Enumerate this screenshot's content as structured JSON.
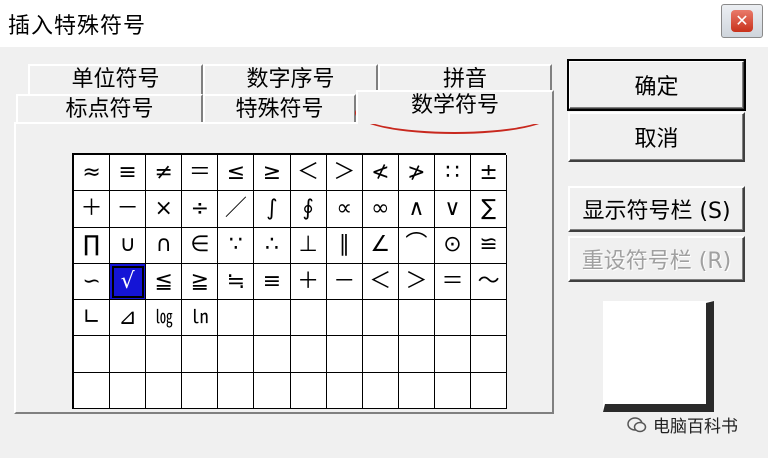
{
  "window": {
    "title": "插入特殊符号",
    "close_glyph": "✕"
  },
  "tabs": {
    "row_back": [
      "单位符号",
      "数字序号",
      "拼音"
    ],
    "row_front": [
      "标点符号",
      "特殊符号",
      "数学符号"
    ],
    "active": "数学符号"
  },
  "symbols": [
    "≈",
    "≡",
    "≠",
    "＝",
    "≤",
    "≥",
    "＜",
    "＞",
    "≮",
    "≯",
    "∷",
    "±",
    "＋",
    "－",
    "×",
    "÷",
    "／",
    "∫",
    "∮",
    "∝",
    "∞",
    "∧",
    "∨",
    "∑",
    "∏",
    "∪",
    "∩",
    "∈",
    "∵",
    "∴",
    "⊥",
    "∥",
    "∠",
    "⌒",
    "⊙",
    "≌",
    "∽",
    "√",
    "≦",
    "≧",
    "≒",
    "≡",
    "＋",
    "－",
    "＜",
    "＞",
    "＝",
    "～",
    "∟",
    "⊿",
    "㏒",
    "㏑",
    "",
    "",
    "",
    "",
    "",
    "",
    "",
    "",
    "",
    "",
    "",
    "",
    "",
    "",
    "",
    "",
    "",
    "",
    "",
    "",
    "",
    "",
    "",
    "",
    "",
    "",
    "",
    "",
    "",
    "",
    "",
    ""
  ],
  "selected_index": 37,
  "buttons": {
    "ok": "确定",
    "cancel": "取消",
    "show_bar": "显示符号栏 ⓈⓈ",
    "reset_bar": "重设符号栏 ⓇⓇ"
  },
  "button_labels": {
    "show_bar": "显示符号栏 (S)",
    "reset_bar": "重设符号栏 (R)"
  },
  "watermark": {
    "text": "电脑百科书"
  },
  "colors": {
    "selection": "#1414d6",
    "annotation_oval": "#c8281e"
  }
}
